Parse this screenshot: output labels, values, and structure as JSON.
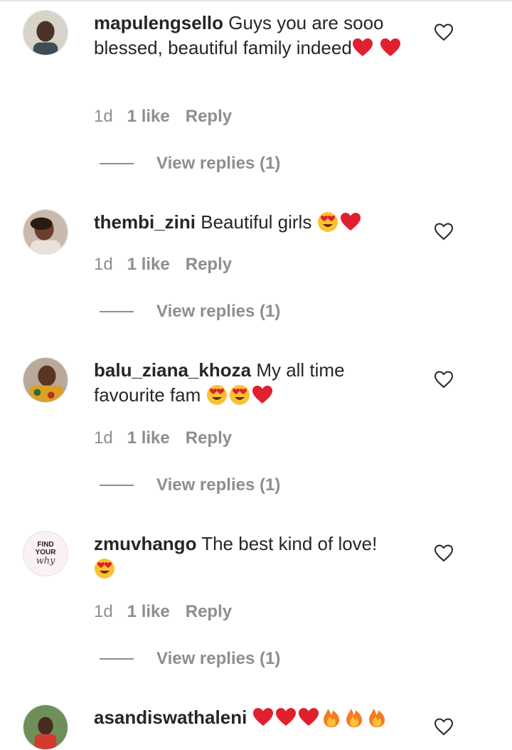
{
  "comments": [
    {
      "username": "mapulengsello",
      "text": "Guys you are sooo blessed, beautiful family indeed",
      "age": "1d",
      "likes": "1 like",
      "reply": "Reply",
      "view_replies": "View replies (1)",
      "emoji": [
        "red-heart",
        "red-heart"
      ]
    },
    {
      "username": "thembi_zini",
      "text": "Beautiful girls",
      "age": "1d",
      "likes": "1 like",
      "reply": "Reply",
      "view_replies": "View replies (1)",
      "emoji": [
        "heart-eyes",
        "red-heart"
      ]
    },
    {
      "username": "balu_ziana_khoza",
      "text": "My all time favourite fam",
      "age": "1d",
      "likes": "1 like",
      "reply": "Reply",
      "view_replies": "View replies (1)",
      "emoji": [
        "heart-eyes",
        "heart-eyes",
        "red-heart"
      ]
    },
    {
      "username": "zmuvhango",
      "text": "The best kind of love!",
      "age": "1d",
      "likes": "1 like",
      "reply": "Reply",
      "view_replies": "View replies (1)",
      "emoji": [
        "heart-eyes"
      ],
      "avatar_text": [
        "FIND",
        "YOUR",
        "why"
      ]
    },
    {
      "username": "asandiswathaleni",
      "text": "",
      "emoji": [
        "red-heart",
        "red-heart",
        "red-heart",
        "fire",
        "fire",
        "fire"
      ]
    }
  ],
  "icons": {
    "like": "heart-outline-icon"
  },
  "colors": {
    "text": "#262626",
    "muted": "#8e8e8e",
    "heart": "#e0202e"
  }
}
